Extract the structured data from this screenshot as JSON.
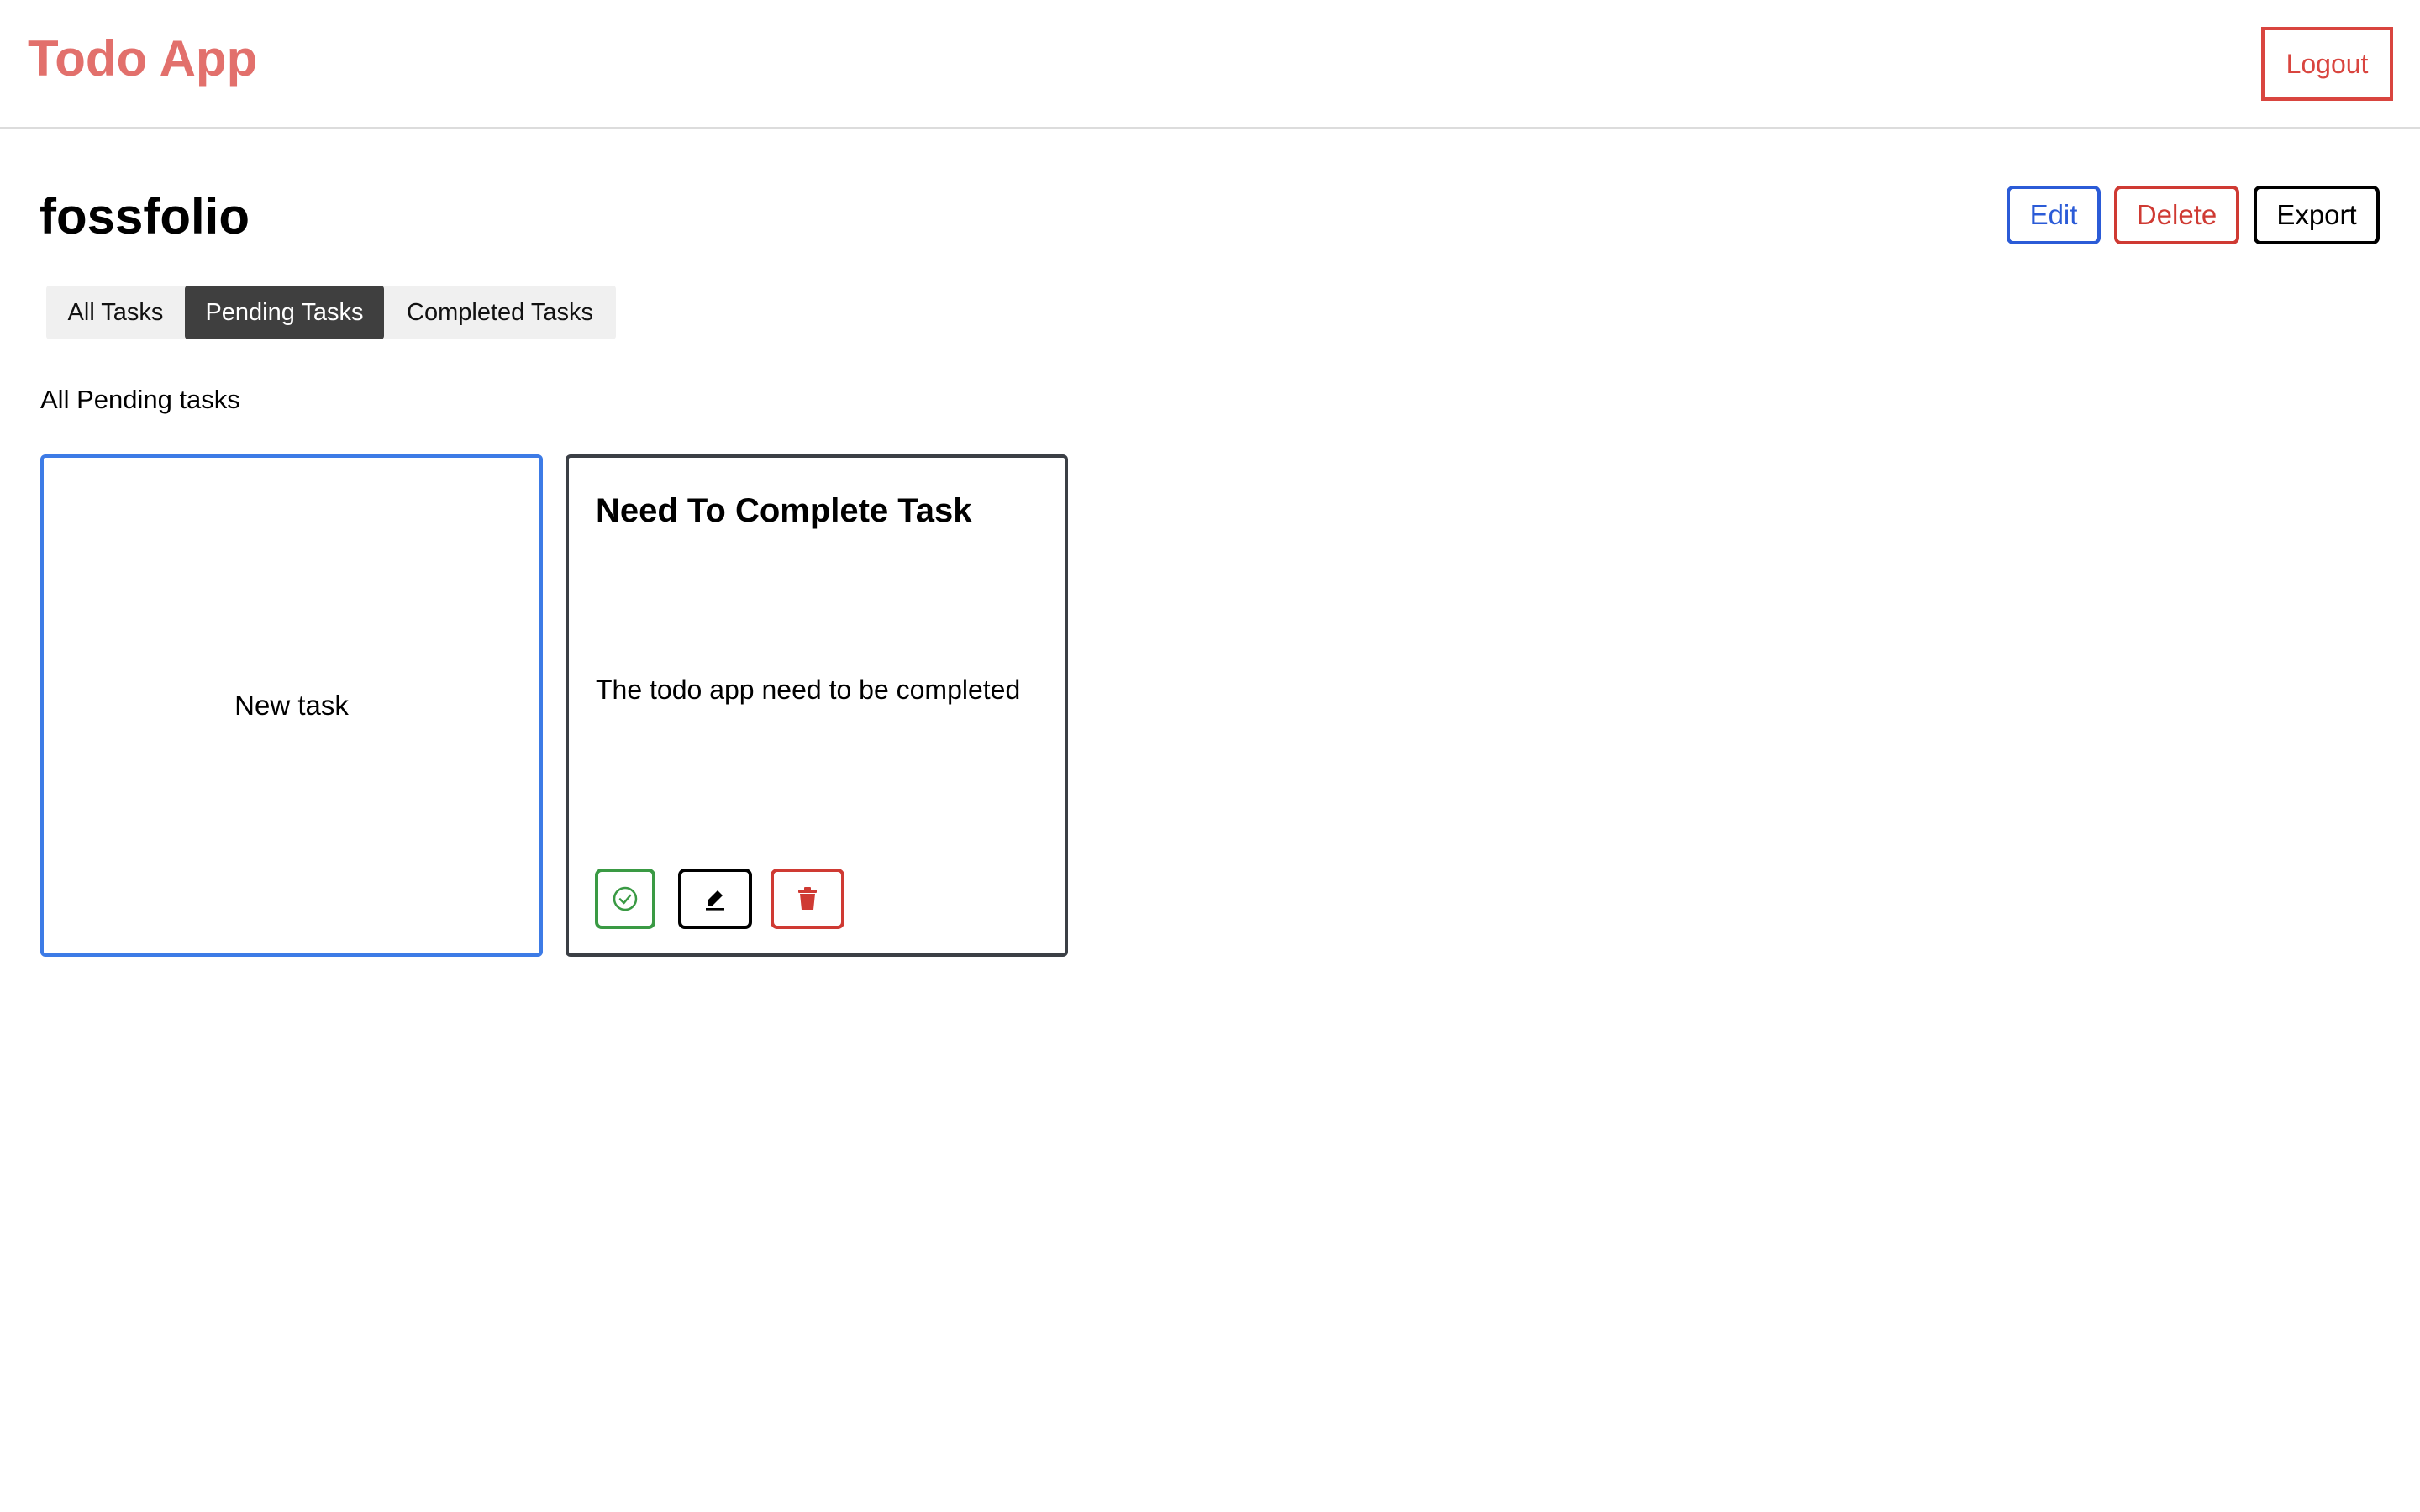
{
  "header": {
    "app_title": "Todo App",
    "logout_label": "Logout"
  },
  "project": {
    "title": "fossfolio",
    "edit_label": "Edit",
    "delete_label": "Delete",
    "export_label": "Export"
  },
  "tabs": [
    {
      "label": "All Tasks",
      "active": false
    },
    {
      "label": "Pending Tasks",
      "active": true
    },
    {
      "label": "Completed Tasks",
      "active": false
    }
  ],
  "section_label": "All Pending tasks",
  "new_task_label": "New task",
  "tasks": [
    {
      "title": "Need To Complete Task",
      "description": "The todo app need to be completed",
      "actions": [
        "check-circle-icon",
        "pencil-icon",
        "trash-icon"
      ]
    }
  ],
  "colors": {
    "brand": "#e2706c",
    "danger": "#cf3a33",
    "primary": "#2b5bd7",
    "success": "#3a9a44",
    "active_tab": "#3f3f3f"
  }
}
